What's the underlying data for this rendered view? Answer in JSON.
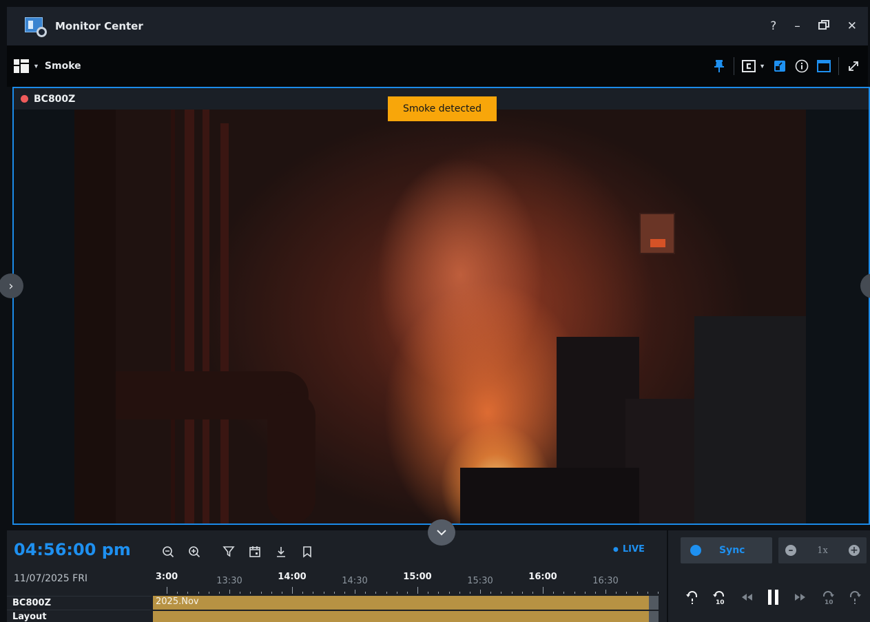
{
  "app": {
    "title": "Monitor Center",
    "window_controls": {
      "help": "?",
      "minimize": "–",
      "restore": "⧉",
      "close": "✕"
    }
  },
  "toolbar": {
    "layout_name": "Smoke",
    "icons": [
      "layout-grid-icon",
      "pin-icon",
      "camera-c-icon",
      "picture-in-picture-icon",
      "info-icon",
      "window-icon",
      "expand-icon"
    ],
    "accent_color": "#1e90f0"
  },
  "camera": {
    "name": "BC800Z",
    "recording": true,
    "recording_color": "#f05b5b",
    "selected_border_color": "#1b8be9"
  },
  "alert": {
    "text": "Smoke detected",
    "color": "#f8a60a"
  },
  "timeline": {
    "current_time": "04:56:00 pm",
    "date": "11/07/2025 FRI",
    "live_label": "LIVE",
    "ticks": [
      {
        "label": "3:00",
        "major": true
      },
      {
        "label": "13:30",
        "major": false
      },
      {
        "label": "14:00",
        "major": true
      },
      {
        "label": "14:30",
        "major": false
      },
      {
        "label": "15:00",
        "major": true
      },
      {
        "label": "15:30",
        "major": false
      },
      {
        "label": "16:00",
        "major": true
      },
      {
        "label": "16:30",
        "major": false
      }
    ],
    "tracks": [
      {
        "label": "BC800Z",
        "bar_text": "2025.Nov"
      },
      {
        "label": "Layout",
        "bar_text": ""
      }
    ],
    "bar_color": "#b79243"
  },
  "controls": {
    "sync_label": "Sync",
    "speed_value": "1x"
  }
}
